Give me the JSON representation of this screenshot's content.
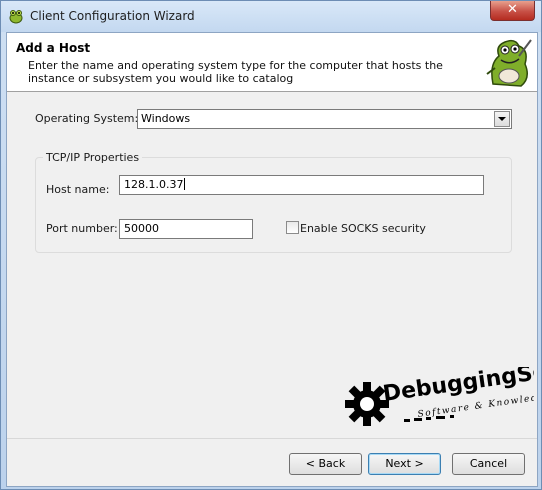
{
  "window": {
    "title": "Client Configuration Wizard",
    "close_symbol": "✕"
  },
  "header": {
    "title": "Add a Host",
    "description": "Enter the name and operating system type for the computer that hosts the instance or subsystem you would like to catalog"
  },
  "form": {
    "os_label": "Operating System:",
    "os_value": "Windows",
    "group_label": "TCP/IP Properties",
    "host_label": "Host name:",
    "host_value": "128.1.0.37",
    "port_label": "Port number:",
    "port_value": "50000",
    "socks_label": "Enable SOCKS security",
    "socks_checked": false
  },
  "watermark": {
    "brand": "DebuggingSoft",
    "tagline": "Software & Knowledge"
  },
  "footer": {
    "back_label": "< Back",
    "next_label": "Next >",
    "cancel_label": "Cancel"
  },
  "colors": {
    "title_bar": "#c3d8f0",
    "close_button": "#c75046",
    "dialog_bg": "#f0f0f0",
    "default_button_border": "#3c7fb1"
  }
}
